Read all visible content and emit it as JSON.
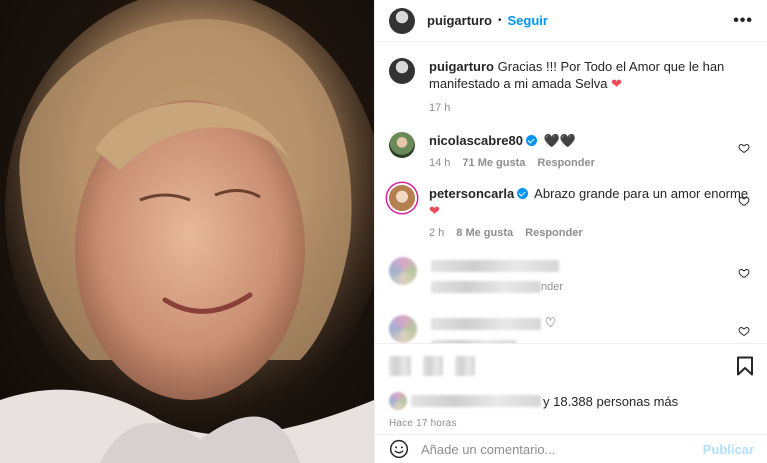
{
  "post": {
    "author": "puigarturo",
    "separator": "•",
    "follow_label": "Seguir",
    "more_label": "•••"
  },
  "caption": {
    "username": "puigarturo",
    "text": "Gracias !!! Por Todo el Amor que le han manifestado a mi amada Selva",
    "emoji": "❤",
    "age": "17 h"
  },
  "comments": [
    {
      "username": "nicolascabre80",
      "text": "🖤🖤",
      "age": "14 h",
      "likes": "71 Me gusta",
      "reply_label": "Responder"
    },
    {
      "username": "petersoncarla",
      "text": "Abrazo grande para un amor enorme",
      "emoji": "❤",
      "age": "2 h",
      "likes": "8 Me gusta",
      "reply_label": "Responder"
    },
    {
      "partial_text": "nder"
    },
    {
      "partial_text": "♡"
    }
  ],
  "liked_by": {
    "text": "y 18.388 personas más"
  },
  "timestamp": "Hace 17 horas",
  "composer": {
    "placeholder": "Añade un comentario...",
    "publish_label": "Publicar"
  },
  "colors": {
    "accent": "#0095f6",
    "heart": "#ed4956",
    "muted": "#8e8e8e",
    "publish_disabled": "#b2dffc"
  }
}
